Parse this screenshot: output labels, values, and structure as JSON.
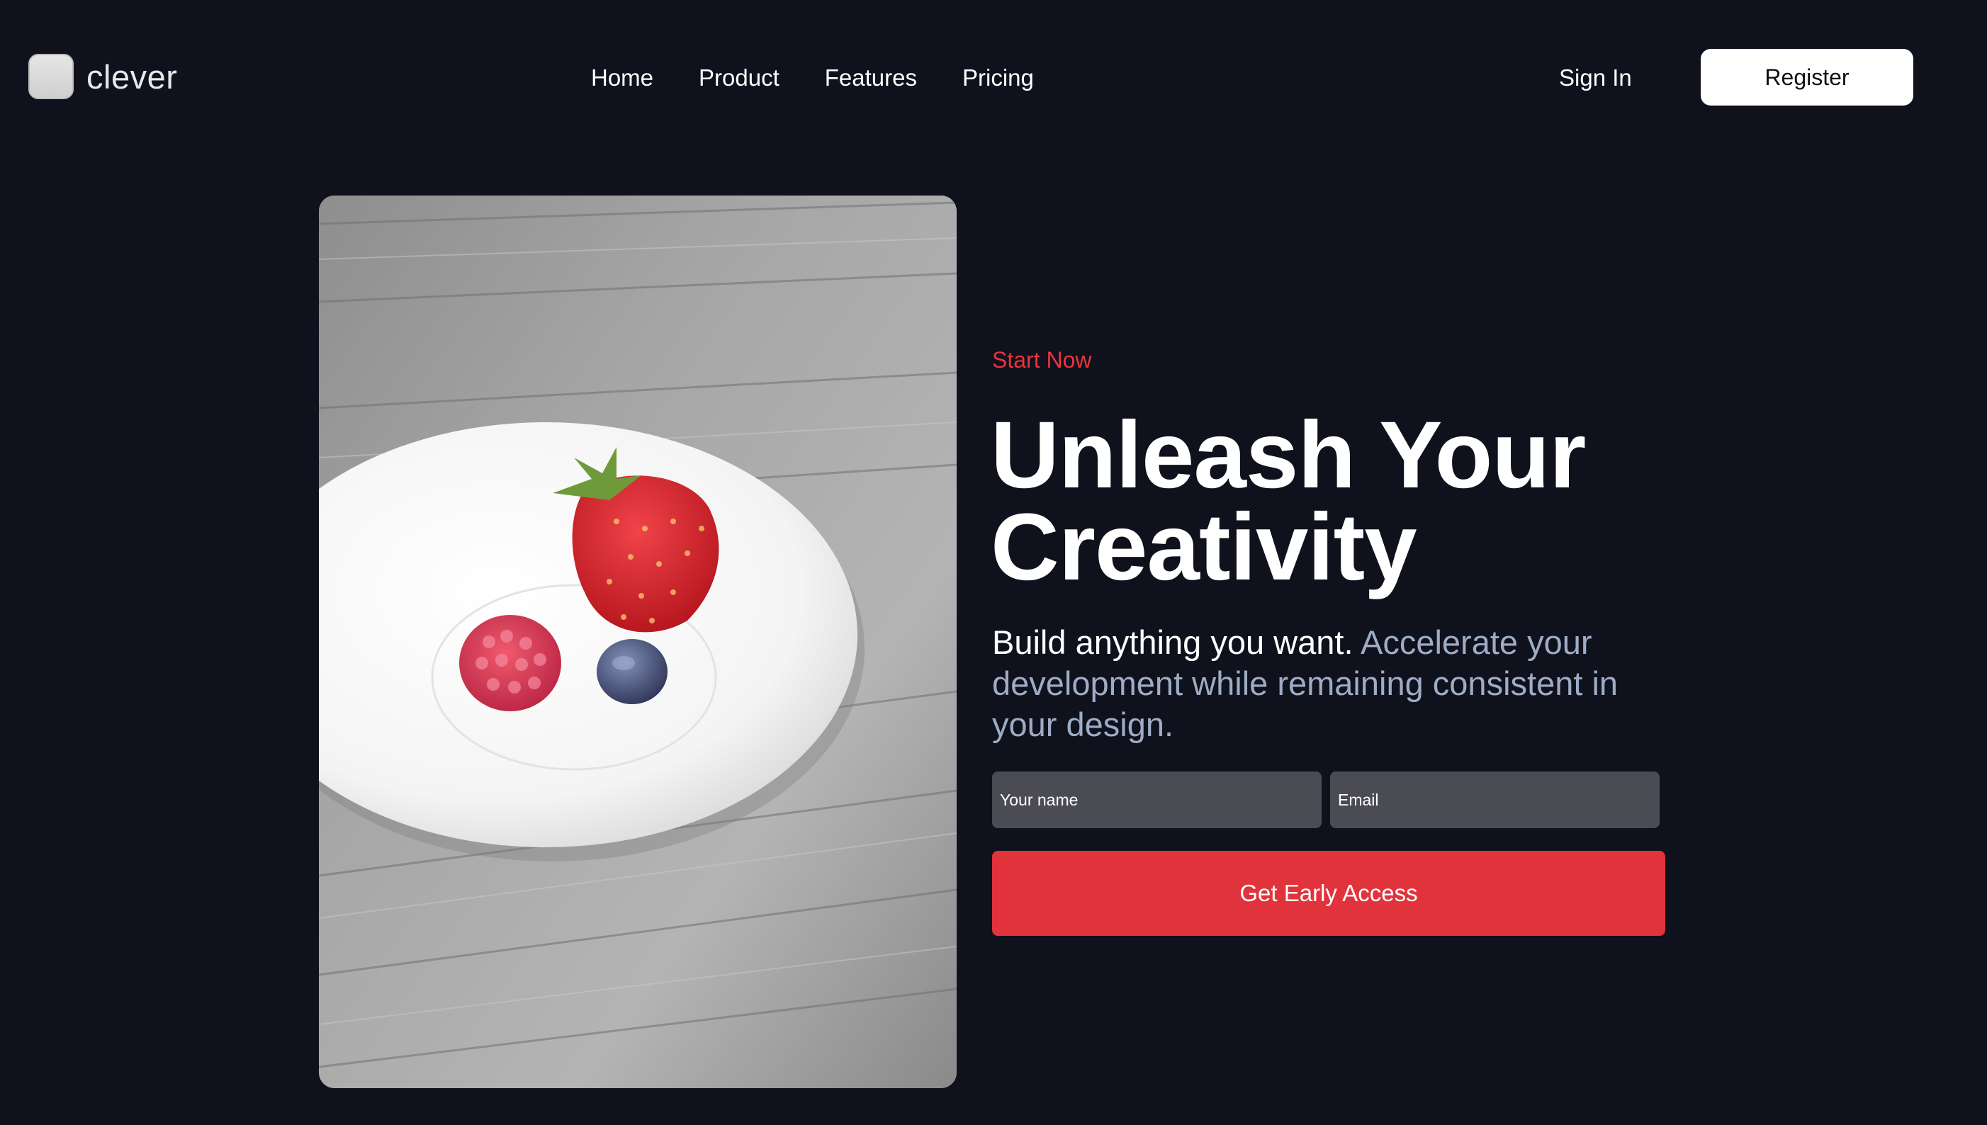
{
  "brand": {
    "name": "clever",
    "logo_icon": "rounded-square-logo-icon"
  },
  "nav": {
    "items": [
      {
        "label": "Home"
      },
      {
        "label": "Product"
      },
      {
        "label": "Features"
      },
      {
        "label": "Pricing"
      }
    ]
  },
  "auth": {
    "signin_label": "Sign In",
    "register_label": "Register"
  },
  "hero": {
    "eyebrow": "Start Now",
    "headline": "Unleash Your Creativity",
    "subtext_lead": "Build anything you want.",
    "subtext_rest": "Accelerate your development while remaining consistent in your design.",
    "image": "berries-on-white-plate-photo"
  },
  "form": {
    "name_placeholder": "Your name",
    "email_placeholder": "Email",
    "submit_label": "Get Early Access"
  },
  "colors": {
    "background": "#0f111d",
    "accent": "#e1333c",
    "eyebrow": "#e8353c",
    "muted_text": "#9eacc5",
    "input_bg": "#4b4b53"
  }
}
